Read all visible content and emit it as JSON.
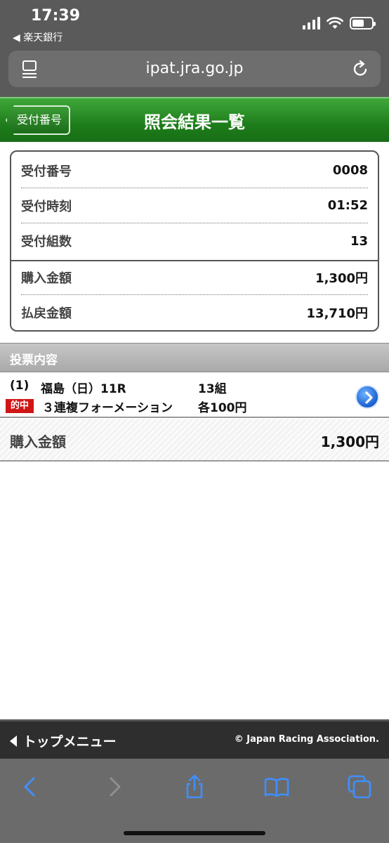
{
  "status": {
    "time": "17:39",
    "back_app": "◀ 楽天銀行"
  },
  "address": {
    "url": "ipat.jra.go.jp"
  },
  "header": {
    "back_label": "受付番号",
    "title": "照会結果一覧"
  },
  "summary": {
    "rows": [
      {
        "label": "受付番号",
        "value": "0008"
      },
      {
        "label": "受付時刻",
        "value": "01:52"
      },
      {
        "label": "受付組数",
        "value": "13"
      },
      {
        "label": "購入金額",
        "value": "1,300円"
      },
      {
        "label": "払戻金額",
        "value": "13,710円"
      }
    ]
  },
  "votes": {
    "section_title": "投票内容",
    "bet": {
      "index": "(1)",
      "race": "福島（日）11R",
      "combos": "13組",
      "badge": "的中",
      "bet_type": "３連複フォーメーション",
      "unit": "各100円"
    },
    "total": {
      "label": "購入金額",
      "value": "1,300円"
    }
  },
  "footer": {
    "menu": "トップメニュー",
    "copyright": "© Japan Racing Association."
  },
  "colors": {
    "header_green": "#1e7d1b",
    "win_red": "#d01515",
    "toolbar_blue": "#3f8fff"
  }
}
